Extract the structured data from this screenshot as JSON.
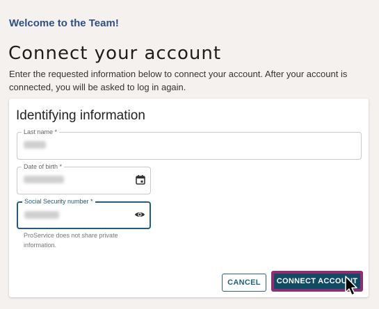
{
  "header": {
    "welcome": "Welcome to the Team!",
    "title": "Connect your account",
    "subtitle": "Enter the requested information below to connect your account. After your account is connected, you will be asked to log in again."
  },
  "form": {
    "section_title": "Identifying information",
    "last_name": {
      "label": "Last name *",
      "value": ""
    },
    "date_of_birth": {
      "label": "Date of birth *",
      "value": ""
    },
    "ssn": {
      "label": "Social Security number *",
      "value": ""
    },
    "ssn_helper": "ProService does not share private information."
  },
  "actions": {
    "cancel_label": "CANCEL",
    "connect_label": "CONNECT ACCOUNT"
  },
  "colors": {
    "welcome": "#2f4f86",
    "primary": "#0f4b63",
    "focus_outline": "#8f2c73",
    "background": "#f4f1ee"
  },
  "icons": {
    "date_of_birth": "calendar-icon",
    "ssn": "eye-icon"
  }
}
